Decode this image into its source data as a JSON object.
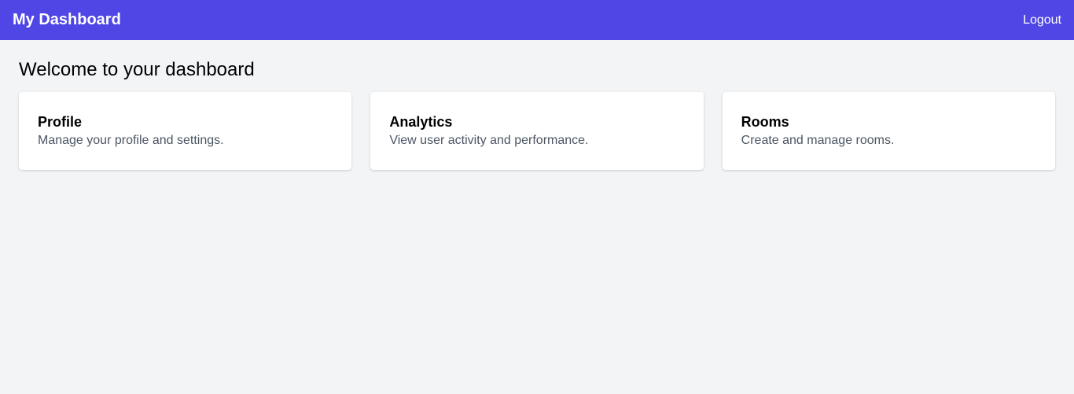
{
  "header": {
    "title": "My Dashboard",
    "logout_label": "Logout",
    "background": "#4f46e5"
  },
  "main": {
    "welcome": "Welcome to your dashboard",
    "cards": [
      {
        "title": "Profile",
        "description": "Manage your profile and settings."
      },
      {
        "title": "Analytics",
        "description": "View user activity and performance."
      },
      {
        "title": "Rooms",
        "description": "Create and manage rooms."
      }
    ]
  }
}
